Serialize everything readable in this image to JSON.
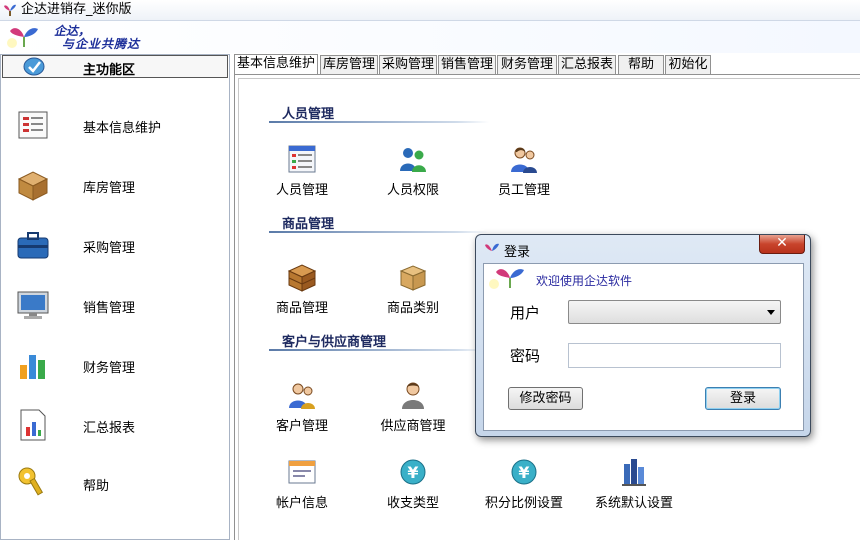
{
  "window": {
    "title": "企达进销存_迷你版"
  },
  "banner": {
    "slogan_line1": "企达，",
    "slogan_line2": "与企业共腾达"
  },
  "sidebar": {
    "header": "主功能区",
    "items": [
      {
        "label": "基本信息维护",
        "icon": "info-form-icon"
      },
      {
        "label": "库房管理",
        "icon": "warehouse-box-icon"
      },
      {
        "label": "采购管理",
        "icon": "briefcase-icon"
      },
      {
        "label": "销售管理",
        "icon": "monitor-icon"
      },
      {
        "label": "财务管理",
        "icon": "bar-chart-icon"
      },
      {
        "label": "汇总报表",
        "icon": "report-icon"
      },
      {
        "label": "帮助",
        "icon": "help-key-icon"
      }
    ]
  },
  "tabs": [
    "基本信息维护",
    "库房管理",
    "采购管理",
    "销售管理",
    "财务管理",
    "汇总报表",
    "帮助",
    "初始化"
  ],
  "sections": [
    {
      "title": "人员管理",
      "tools": [
        "人员管理",
        "人员权限",
        "员工管理"
      ]
    },
    {
      "title": "商品管理",
      "tools": [
        "商品管理",
        "商品类别"
      ]
    },
    {
      "title": "客户与供应商管理",
      "tools": [
        "客户管理",
        "供应商管理"
      ]
    }
  ],
  "extra_tools": [
    "帐户信息",
    "收支类型",
    "积分比例设置",
    "系统默认设置"
  ],
  "login": {
    "title": "登录",
    "close": "✕",
    "welcome": "欢迎使用企达软件",
    "user_label": "用户",
    "user_value": "",
    "password_label": "密码",
    "password_value": "",
    "change_password": "修改密码",
    "login": "登录"
  },
  "colors": {
    "accent": "#1d2f9a",
    "section_line": "#5a7aa8",
    "close_button": "#c8442c"
  }
}
